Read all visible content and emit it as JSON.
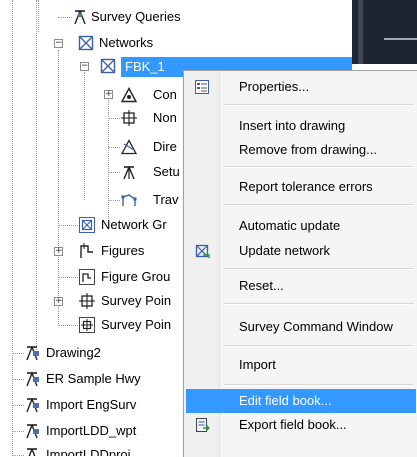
{
  "tree": {
    "items": [
      {
        "label": "Survey Queries",
        "icon": "survey-queries-icon"
      },
      {
        "label": "Networks",
        "icon": "networks-icon"
      },
      {
        "label": "FBK_1",
        "icon": "network-icon"
      },
      {
        "label": "Con",
        "icon": "control-points-icon"
      },
      {
        "label": "Non",
        "icon": "non-control-points-icon"
      },
      {
        "label": "Dire",
        "icon": "directions-icon"
      },
      {
        "label": "Setu",
        "icon": "setups-icon"
      },
      {
        "label": "Trav",
        "icon": "traverses-icon"
      },
      {
        "label": "Network Gr",
        "icon": "network-groups-icon"
      },
      {
        "label": "Figures",
        "icon": "figures-icon"
      },
      {
        "label": "Figure Grou",
        "icon": "figure-groups-icon"
      },
      {
        "label": "Survey Poin",
        "icon": "survey-points-icon"
      },
      {
        "label": "Survey Poin",
        "icon": "survey-point-groups-icon"
      },
      {
        "label": "Drawing2",
        "icon": "drawing-icon"
      },
      {
        "label": "ER Sample Hwy",
        "icon": "drawing-icon"
      },
      {
        "label": "Import EngSurv",
        "icon": "drawing-icon"
      },
      {
        "label": "ImportLDD_wpt",
        "icon": "drawing-icon"
      },
      {
        "label": "ImportLDDproi",
        "icon": "drawing-icon"
      }
    ]
  },
  "context_menu": {
    "items": [
      {
        "label": "Properties...",
        "icon": "properties-icon"
      },
      {
        "label": "Insert into drawing"
      },
      {
        "label": "Remove from drawing..."
      },
      {
        "label": "Report tolerance errors"
      },
      {
        "label": "Automatic update"
      },
      {
        "label": "Update network",
        "icon": "update-network-icon"
      },
      {
        "label": "Reset..."
      },
      {
        "label": "Survey Command Window"
      },
      {
        "label": "Import"
      },
      {
        "label": "Edit field book..."
      },
      {
        "label": "Export field book...",
        "icon": "export-field-book-icon"
      }
    ],
    "highlighted": "Edit field book..."
  },
  "colors": {
    "selection": "#3399ff",
    "menu_background": "#f5f5f5",
    "dark_panel": "#1e2530"
  }
}
